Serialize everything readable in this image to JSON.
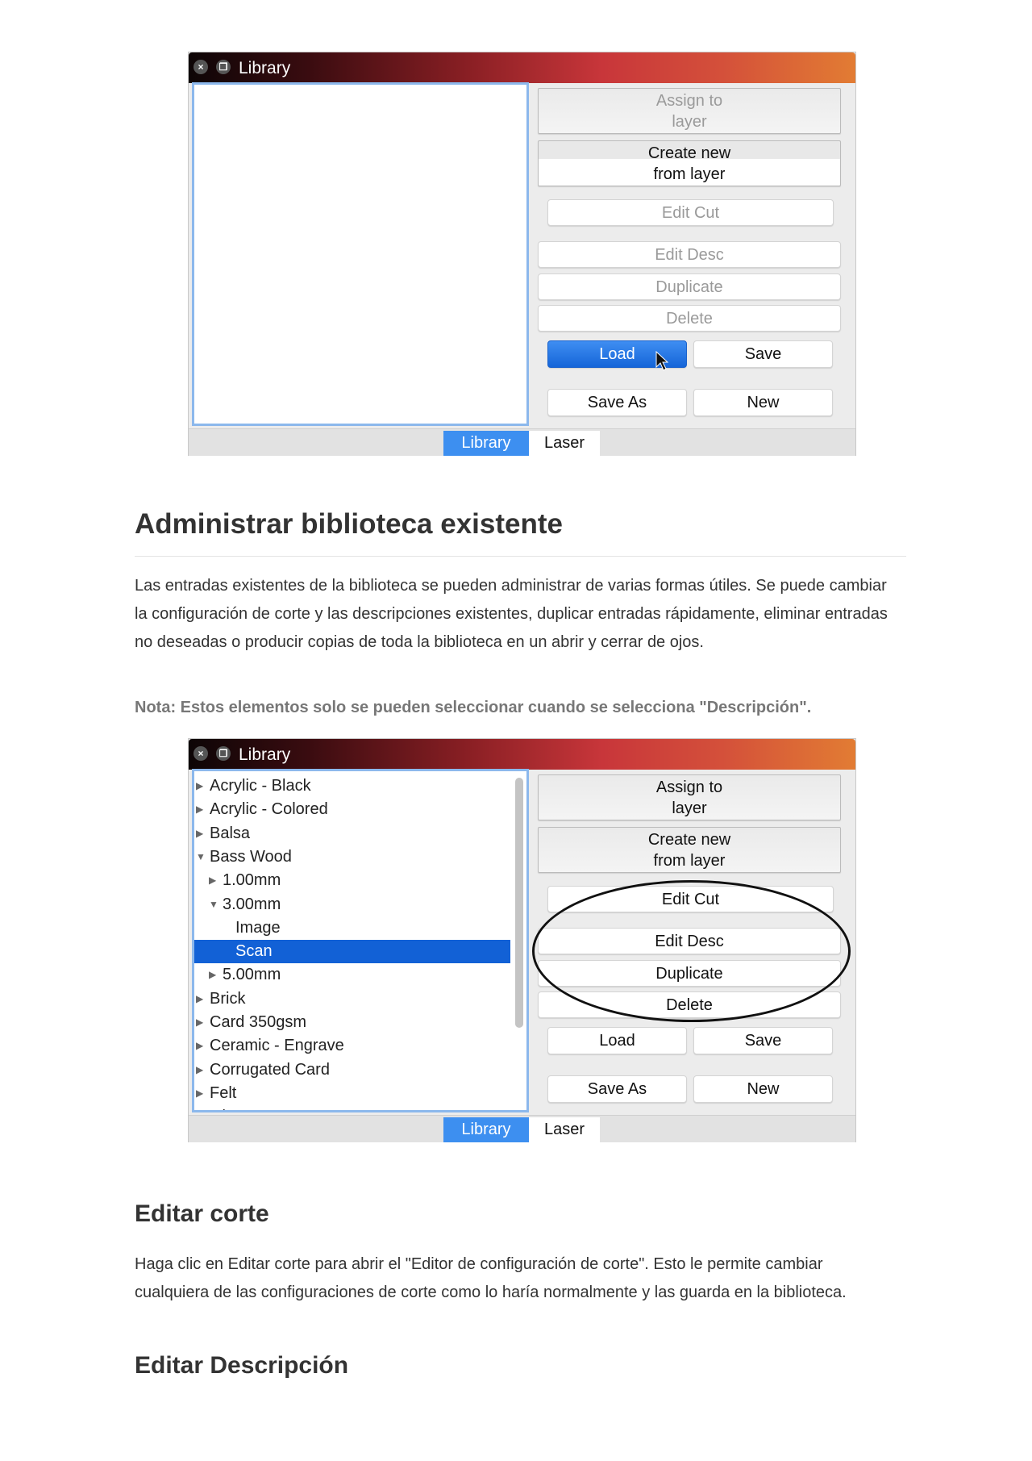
{
  "window1": {
    "title": "Library",
    "buttons": {
      "assign_l1": "Assign to",
      "assign_l2": "layer",
      "create_l1": "Create new",
      "create_l2": "from layer",
      "edit_cut": "Edit Cut",
      "edit_desc": "Edit Desc",
      "duplicate": "Duplicate",
      "delete": "Delete",
      "load": "Load",
      "save": "Save",
      "save_as": "Save As",
      "new": "New"
    },
    "tabs": [
      "Library",
      "Laser"
    ]
  },
  "section": {
    "heading": "Administrar biblioteca existente",
    "paragraph": "Las entradas existentes de la biblioteca se pueden administrar de varias formas útiles. Se puede cambiar la configuración de corte y las descripciones existentes, duplicar entradas rápidamente, eliminar entradas no deseadas o producir copias de toda la biblioteca en un abrir y cerrar de ojos.",
    "note": "Nota: Estos elementos solo se pueden seleccionar cuando se selecciona \"Descripción\"."
  },
  "window2": {
    "title": "Library",
    "tree": [
      {
        "label": "Acrylic - Black",
        "level": 0,
        "state": "collapsed"
      },
      {
        "label": "Acrylic - Colored",
        "level": 0,
        "state": "collapsed"
      },
      {
        "label": "Balsa",
        "level": 0,
        "state": "collapsed"
      },
      {
        "label": "Bass Wood",
        "level": 0,
        "state": "expanded"
      },
      {
        "label": "1.00mm",
        "level": 1,
        "state": "collapsed"
      },
      {
        "label": "3.00mm",
        "level": 1,
        "state": "expanded"
      },
      {
        "label": "Image",
        "level": 2,
        "state": "leaf"
      },
      {
        "label": "Scan",
        "level": 2,
        "state": "leaf",
        "selected": true
      },
      {
        "label": "5.00mm",
        "level": 1,
        "state": "collapsed"
      },
      {
        "label": "Brick",
        "level": 0,
        "state": "collapsed"
      },
      {
        "label": "Card 350gsm",
        "level": 0,
        "state": "collapsed"
      },
      {
        "label": "Ceramic - Engrave",
        "level": 0,
        "state": "collapsed"
      },
      {
        "label": "Corrugated Card",
        "level": 0,
        "state": "collapsed"
      },
      {
        "label": "Felt",
        "level": 0,
        "state": "collapsed"
      },
      {
        "label": "Glass - E...",
        "level": 0,
        "state": "collapsed"
      }
    ],
    "buttons": {
      "assign_l1": "Assign to",
      "assign_l2": "layer",
      "create_l1": "Create new",
      "create_l2": "from layer",
      "edit_cut": "Edit Cut",
      "edit_desc": "Edit Desc",
      "duplicate": "Duplicate",
      "delete": "Delete",
      "load": "Load",
      "save": "Save",
      "save_as": "Save As",
      "new": "New"
    },
    "tabs": [
      "Library",
      "Laser"
    ]
  },
  "edit_cut": {
    "heading": "Editar corte",
    "paragraph": "Haga clic en Editar corte para abrir el \"Editor de configuración de corte\". Esto le permite cambiar cualquiera de las configuraciones de corte como lo haría normalmente y las guarda en la biblioteca."
  },
  "edit_desc": {
    "heading": "Editar Descripción"
  },
  "colors": {
    "accent": "#1261d6",
    "titlebar_start": "#0d0506",
    "titlebar_end": "#e27c33"
  }
}
